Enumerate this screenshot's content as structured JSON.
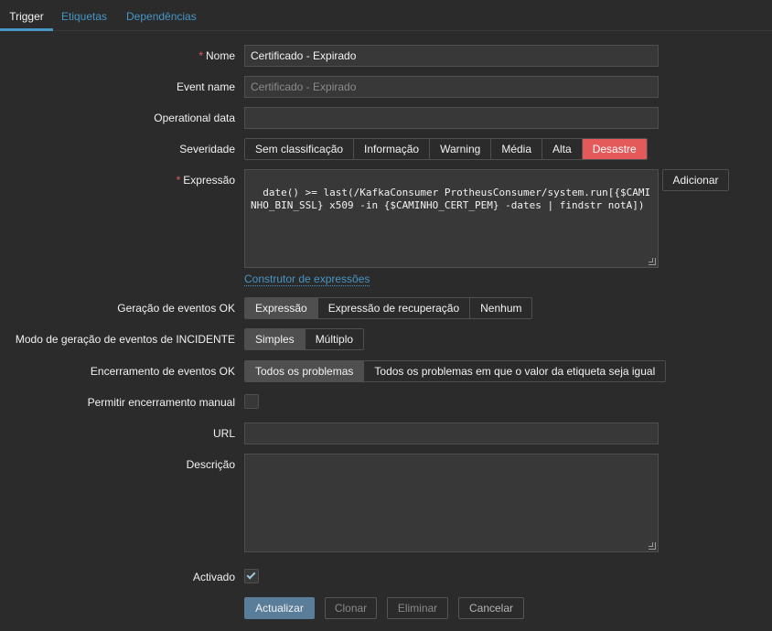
{
  "tabs": [
    "Trigger",
    "Etiquetas",
    "Dependências"
  ],
  "form": {
    "name": {
      "label": "Nome",
      "value": "Certificado - Expirado"
    },
    "event_name": {
      "label": "Event name",
      "placeholder": "Certificado - Expirado"
    },
    "operational_data": {
      "label": "Operational data",
      "value": ""
    },
    "severity": {
      "label": "Severidade",
      "options": [
        "Sem classificação",
        "Informação",
        "Warning",
        "Média",
        "Alta",
        "Desastre"
      ],
      "selected": "Desastre",
      "selected_color": "#e45959"
    },
    "expression": {
      "label": "Expressão",
      "value": "date() >= last(/KafkaConsumer ProtheusConsumer/system.run[{$CAMINHO_BIN_SSL} x509 -in {$CAMINHO_CERT_PEM} -dates | findstr notA])",
      "add_button": "Adicionar",
      "builder_link": "Construtor de expressões"
    },
    "ok_event_generation": {
      "label": "Geração de eventos OK",
      "options": [
        "Expressão",
        "Expressão de recuperação",
        "Nenhum"
      ],
      "selected": "Expressão"
    },
    "problem_event_mode": {
      "label": "Modo de geração de eventos de INCIDENTE",
      "options": [
        "Simples",
        "Múltiplo"
      ],
      "selected": "Simples"
    },
    "ok_event_closes": {
      "label": "Encerramento de eventos OK",
      "options": [
        "Todos os problemas",
        "Todos os problemas em que o valor da etiqueta seja igual"
      ],
      "selected": "Todos os problemas"
    },
    "manual_close": {
      "label": "Permitir encerramento manual",
      "checked": false
    },
    "url": {
      "label": "URL",
      "value": ""
    },
    "description": {
      "label": "Descrição",
      "value": ""
    },
    "enabled": {
      "label": "Activado",
      "checked": true
    }
  },
  "buttons": {
    "update": "Actualizar",
    "clone": "Clonar",
    "delete": "Eliminar",
    "cancel": "Cancelar"
  },
  "colors": {
    "background": "#2b2b2b",
    "input_bg": "#383838",
    "accent": "#4796c4",
    "disaster": "#e45959",
    "primary_button": "#5a7d99"
  }
}
